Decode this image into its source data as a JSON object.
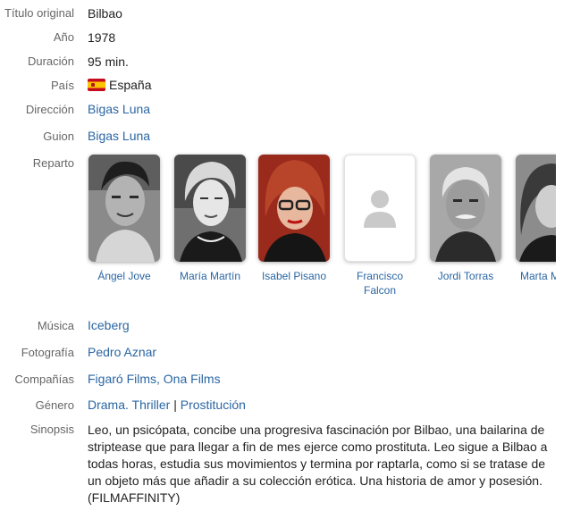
{
  "labels": {
    "original_title": "Título original",
    "year": "Año",
    "duration": "Duración",
    "country": "País",
    "direction": "Dirección",
    "script": "Guion",
    "cast": "Reparto",
    "music": "Música",
    "photography": "Fotografía",
    "companies": "Compañías",
    "genre": "Género",
    "synopsis": "Sinopsis"
  },
  "values": {
    "original_title": "Bilbao",
    "year": "1978",
    "duration": "95 min.",
    "country": "España",
    "country_flag_icon": "spain-flag-icon",
    "direction": "Bigas Luna",
    "script": "Bigas Luna",
    "music": "Iceberg",
    "photography": "Pedro Aznar",
    "companies": [
      "Figaró Films",
      "Ona Films"
    ],
    "companies_separator": ", ",
    "genre": [
      "Drama",
      "Thriller"
    ],
    "genre_separator": ". ",
    "genre_divider": "|",
    "topic": "Prostitución",
    "synopsis": "Leo, un psicópata, concibe una progresiva fascinación por Bilbao, una bailarina de striptease que para llegar a fin de mes ejerce como prostituta. Leo sigue a Bilbao a todas horas, estudia sus movimientos y termina por raptarla, como si se tratase de un objeto más que añadir a su colección erótica. Una historia de amor y posesión. (FILMAFFINITY)"
  },
  "cast": [
    {
      "name": "Ángel Jove",
      "photo": "portrait-photo"
    },
    {
      "name": "María Martín",
      "photo": "portrait-photo"
    },
    {
      "name": "Isabel Pisano",
      "photo": "portrait-photo"
    },
    {
      "name": "Francisco\nFalcon",
      "photo": "user-placeholder-icon"
    },
    {
      "name": "Jordi Torras",
      "photo": "portrait-photo"
    },
    {
      "name": "Marta M",
      "photo": "portrait-photo"
    }
  ],
  "colors": {
    "link": "#2a66a3",
    "label": "#666666",
    "text": "#222222"
  }
}
